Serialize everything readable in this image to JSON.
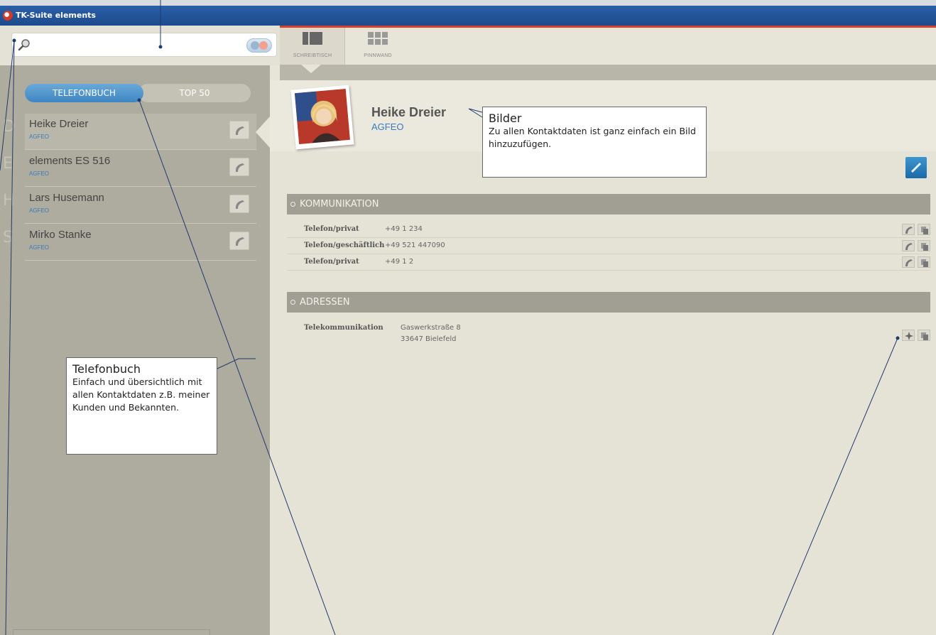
{
  "window": {
    "title": "TK-Suite elements"
  },
  "search": {
    "placeholder": "",
    "value": ""
  },
  "view_tabs": [
    {
      "label": "SCHREIBTISCH",
      "active": true
    },
    {
      "label": "PINNWAND",
      "active": false
    }
  ],
  "list_tabs": [
    {
      "label": "TELEFONBUCH",
      "active": true
    },
    {
      "label": "TOP 50",
      "active": false
    }
  ],
  "contacts": [
    {
      "letter": "D",
      "name": "Heike Dreier",
      "company": "AGFEO",
      "selected": true
    },
    {
      "letter": "E",
      "name": "elements ES 516",
      "company": "AGFEO",
      "selected": false
    },
    {
      "letter": "H",
      "name": "Lars Husemann",
      "company": "AGFEO",
      "selected": false
    },
    {
      "letter": "S",
      "name": "Mirko Stanke",
      "company": "AGFEO",
      "selected": false
    }
  ],
  "detail": {
    "name": "Heike Dreier",
    "company": "AGFEO",
    "sections": {
      "communication": "KOMMUNIKATION",
      "addresses": "ADRESSEN"
    },
    "phones": [
      {
        "label": "Telefon/privat",
        "value": "+49 1 234"
      },
      {
        "label": "Telefon/geschäftlich",
        "value": "+49 521 447090"
      },
      {
        "label": "Telefon/privat",
        "value": "+49 1 2"
      }
    ],
    "address": {
      "label": "Telekommunikation",
      "street": "Gaswerkstraße 8",
      "city": "33647 Bielefeld"
    }
  },
  "callouts": {
    "telefonbuch": {
      "title": "Telefonbuch",
      "text": "Einfach und übersichtlich mit allen Kontaktdaten z.B. meiner Kunden und Bekannten."
    },
    "bilder": {
      "title": "Bilder",
      "text": "Zu allen Kontaktdaten ist ganz einfach ein Bild hinzuzufügen."
    }
  },
  "colors": {
    "titlebar": "#1d4a8c",
    "accent_red": "#d7402b",
    "tab_blue": "#3e86c2",
    "link_blue": "#3a7abe",
    "section_grey": "#a19e93",
    "left_panel": "#aeab9f"
  }
}
